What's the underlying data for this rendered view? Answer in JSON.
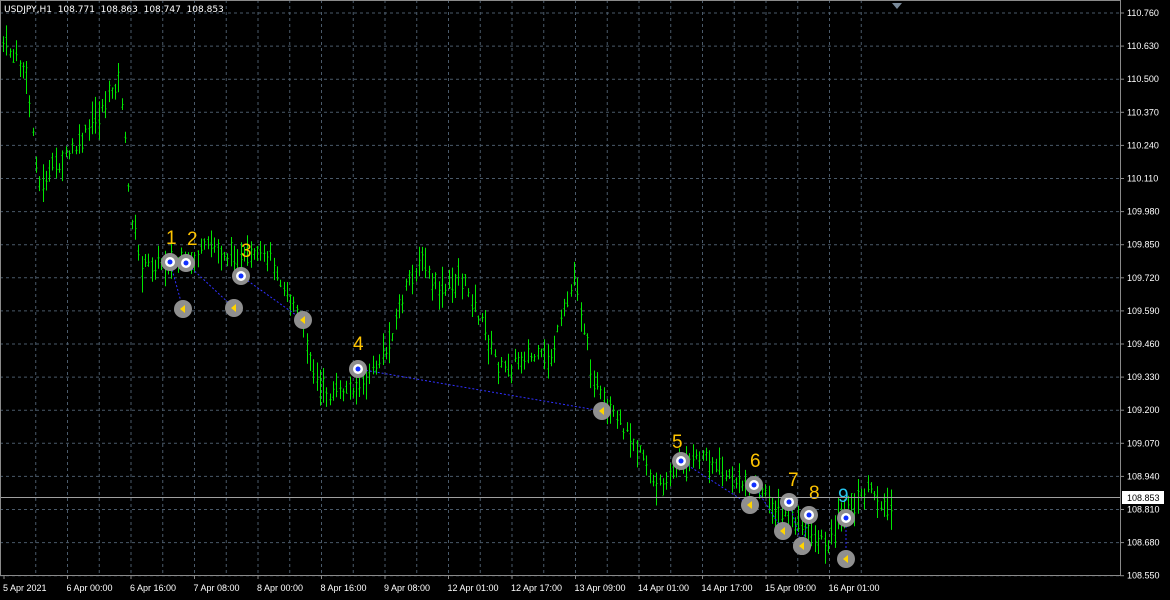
{
  "header": {
    "symbol": "USDJPY,H1",
    "open": "108.771",
    "high": "108.863",
    "low": "108.747",
    "close": "108.853"
  },
  "price_axis": {
    "ticks": [
      "110.760",
      "110.630",
      "110.500",
      "110.370",
      "110.240",
      "110.110",
      "109.980",
      "109.850",
      "109.720",
      "109.590",
      "109.460",
      "109.330",
      "109.200",
      "109.070",
      "108.940",
      "108.810",
      "108.680",
      "108.550"
    ],
    "current_price": "108.853"
  },
  "time_axis": {
    "ticks": [
      "5 Apr 2021",
      "6 Apr 00:00",
      "6 Apr 16:00",
      "7 Apr 08:00",
      "8 Apr 00:00",
      "8 Apr 16:00",
      "9 Apr 08:00",
      "12 Apr 01:00",
      "12 Apr 17:00",
      "13 Apr 09:00",
      "14 Apr 01:00",
      "14 Apr 17:00",
      "15 Apr 09:00",
      "16 Apr 01:00"
    ]
  },
  "colors": {
    "background": "#000000",
    "candle": "#00e600",
    "grid": "#4a5a6a",
    "trade_line": "#3030ff",
    "label_yellow": "#ffc400",
    "label_cyan": "#26c6f0",
    "bid_line": "#a0a0a0"
  },
  "trades": [
    {
      "label": "1",
      "color": "yellow"
    },
    {
      "label": "2",
      "color": "yellow"
    },
    {
      "label": "3",
      "color": "yellow"
    },
    {
      "label": "4",
      "color": "yellow"
    },
    {
      "label": "5",
      "color": "yellow"
    },
    {
      "label": "6",
      "color": "yellow"
    },
    {
      "label": "7",
      "color": "yellow"
    },
    {
      "label": "8",
      "color": "yellow"
    },
    {
      "label": "9",
      "color": "cyan"
    }
  ],
  "icons": {
    "entry": "buy-entry-icon",
    "exit": "close-arrow-icon",
    "shift": "chart-shift-triangle-icon"
  }
}
